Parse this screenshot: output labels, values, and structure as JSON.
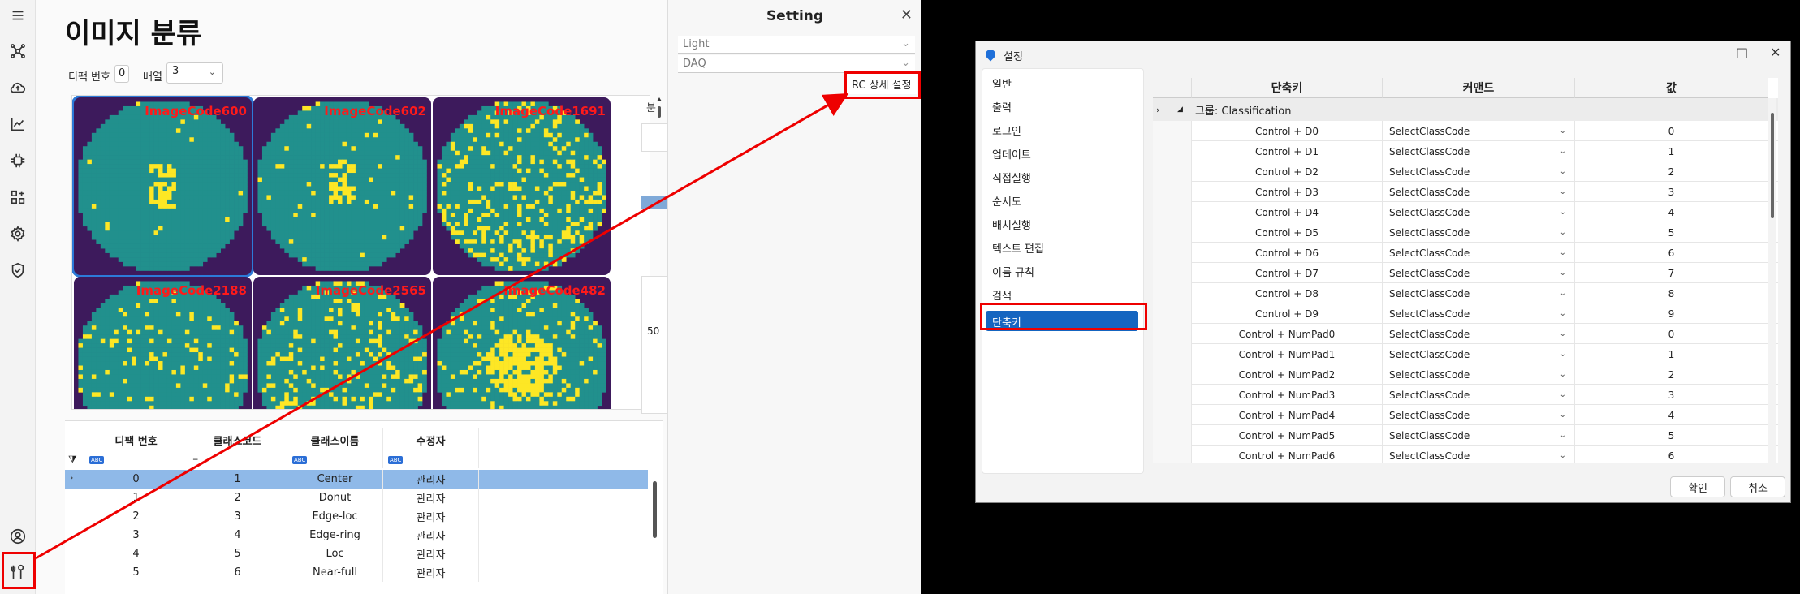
{
  "app": {
    "title": "이미지 분류",
    "defect_label": "디팩 번호",
    "defect_value": "0",
    "array_label": "배열",
    "array_value": "3",
    "tiles": [
      {
        "code": "ImageCode600"
      },
      {
        "code": "ImageCode602"
      },
      {
        "code": "ImageCode1691"
      },
      {
        "code": "ImageCode2188"
      },
      {
        "code": "ImageCode2565"
      },
      {
        "code": "ImageCode482"
      }
    ],
    "table": {
      "headers": [
        "디팩 번호",
        "클래스코드",
        "클래스이름",
        "수정자"
      ],
      "filter_tag": "ABC",
      "rows": [
        [
          "0",
          "1",
          "Center",
          "관리자"
        ],
        [
          "1",
          "2",
          "Donut",
          "관리자"
        ],
        [
          "2",
          "3",
          "Edge-loc",
          "관리자"
        ],
        [
          "3",
          "4",
          "Edge-ring",
          "관리자"
        ],
        [
          "4",
          "5",
          "Loc",
          "관리자"
        ],
        [
          "5",
          "6",
          "Near-full",
          "관리자"
        ]
      ]
    },
    "side_fragment_1": "분",
    "side_fragment_2": "50"
  },
  "setting_panel": {
    "title": "Setting",
    "theme": "Light",
    "daq": "DAQ",
    "rc_button": "RC 상세 설정"
  },
  "dialog": {
    "title": "설정",
    "nav": [
      "일반",
      "출력",
      "로그인",
      "업데이트",
      "직접실행",
      "순서도",
      "배치실행",
      "텍스트 편집",
      "이름 규칙",
      "검색",
      "단축키"
    ],
    "active_nav": "단축키",
    "headers": [
      "단축키",
      "커맨드",
      "값"
    ],
    "group": "그룹: Classification",
    "rows": [
      [
        "Control + D0",
        "SelectClassCode",
        "0"
      ],
      [
        "Control + D1",
        "SelectClassCode",
        "1"
      ],
      [
        "Control + D2",
        "SelectClassCode",
        "2"
      ],
      [
        "Control + D3",
        "SelectClassCode",
        "3"
      ],
      [
        "Control + D4",
        "SelectClassCode",
        "4"
      ],
      [
        "Control + D5",
        "SelectClassCode",
        "5"
      ],
      [
        "Control + D6",
        "SelectClassCode",
        "6"
      ],
      [
        "Control + D7",
        "SelectClassCode",
        "7"
      ],
      [
        "Control + D8",
        "SelectClassCode",
        "8"
      ],
      [
        "Control + D9",
        "SelectClassCode",
        "9"
      ],
      [
        "Control + NumPad0",
        "SelectClassCode",
        "0"
      ],
      [
        "Control + NumPad1",
        "SelectClassCode",
        "1"
      ],
      [
        "Control + NumPad2",
        "SelectClassCode",
        "2"
      ],
      [
        "Control + NumPad3",
        "SelectClassCode",
        "3"
      ],
      [
        "Control + NumPad4",
        "SelectClassCode",
        "4"
      ],
      [
        "Control + NumPad5",
        "SelectClassCode",
        "5"
      ],
      [
        "Control + NumPad6",
        "SelectClassCode",
        "6"
      ]
    ],
    "ok": "확인",
    "cancel": "취소"
  },
  "colors": {
    "wafer_bg": "#3d1a5c",
    "wafer_die": "#21908d",
    "wafer_defect": "#fde725",
    "accent": "#1565c0",
    "annotation": "#e00000",
    "tile_code": "#ff1a1a"
  },
  "icons": [
    "menu-icon",
    "network-icon",
    "cloud-upload-icon",
    "chart-line-icon",
    "chip-icon",
    "apps-add-icon",
    "gear-icon",
    "shield-check-icon",
    "user-circle-icon",
    "tools-icon"
  ]
}
